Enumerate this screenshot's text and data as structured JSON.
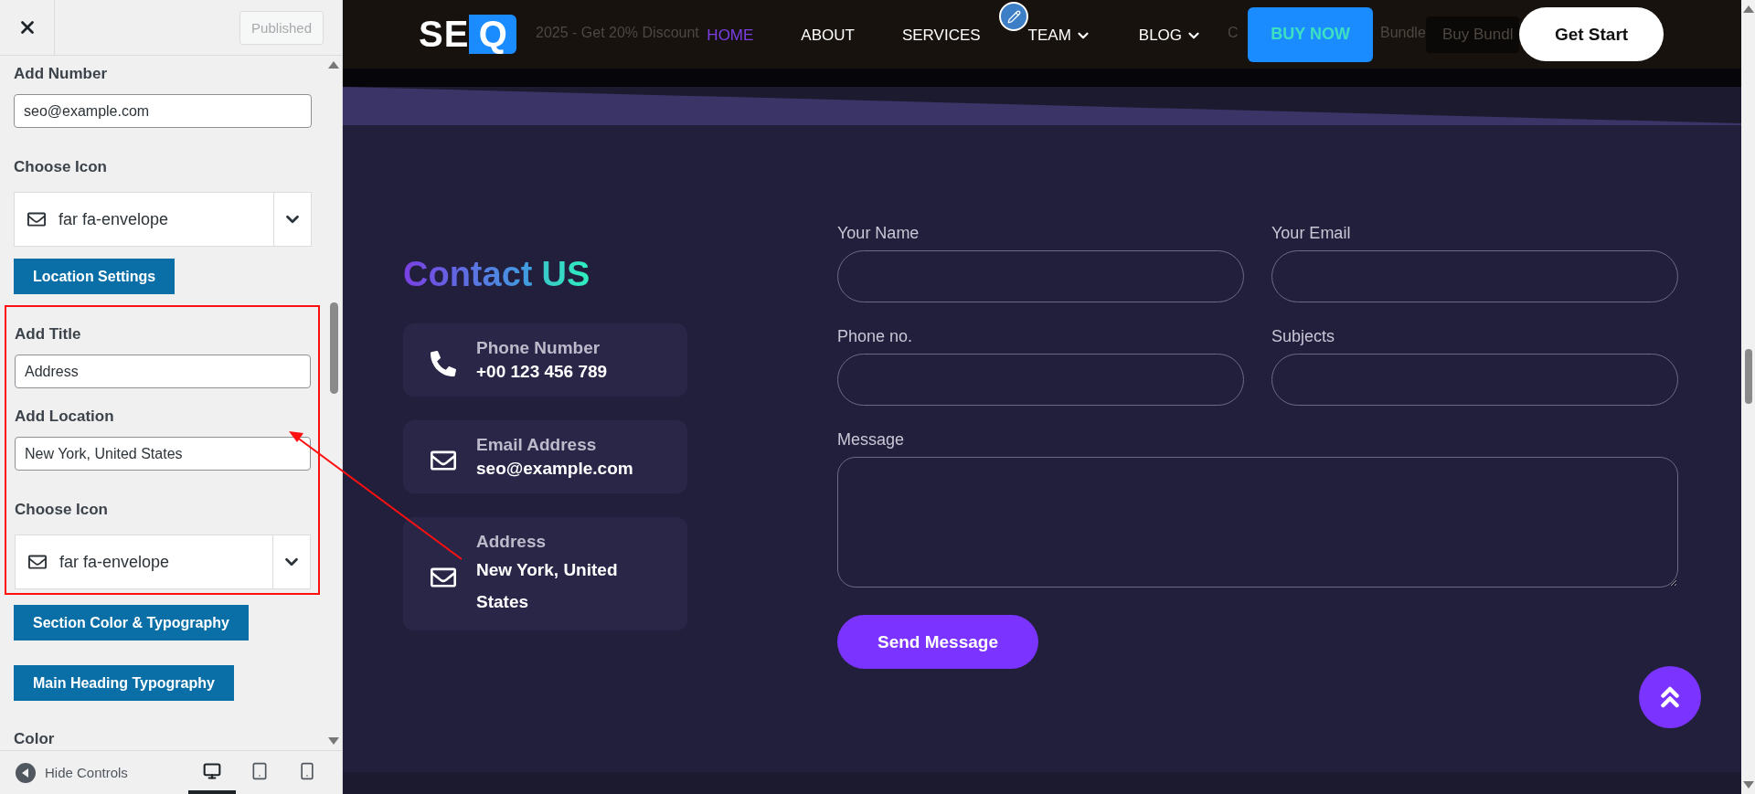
{
  "customizer": {
    "publish_button": "Published",
    "controls": [
      {
        "kind": "text",
        "label": "Add Number",
        "value": "seo@example.com"
      },
      {
        "kind": "icon_select",
        "label": "Choose Icon",
        "value": "far fa-envelope"
      },
      {
        "kind": "button",
        "label": "Location Settings"
      },
      {
        "kind": "group",
        "highlighted": true,
        "children": [
          {
            "kind": "text",
            "label": "Add Title",
            "value": "Address"
          },
          {
            "kind": "text",
            "label": "Add Location",
            "value": "New York, United States"
          },
          {
            "kind": "icon_select",
            "label": "Choose Icon",
            "value": "far fa-envelope"
          }
        ]
      },
      {
        "kind": "button",
        "label": "Section Color & Typography"
      },
      {
        "kind": "button",
        "label": "Main Heading Typography"
      },
      {
        "kind": "heading",
        "label": "Color"
      }
    ],
    "hide_controls": "Hide Controls",
    "devices": [
      {
        "kind": "desktop",
        "selected": true
      },
      {
        "kind": "tablet",
        "selected": false
      },
      {
        "kind": "mobile",
        "selected": false
      }
    ]
  },
  "preview": {
    "banner": [
      {
        "kind": "text",
        "text": "2025 - Get 20% Discount"
      },
      {
        "kind": "text",
        "text": "C"
      },
      {
        "kind": "text",
        "text": "Bundle"
      },
      {
        "kind": "pill",
        "text": "Buy Bundl"
      }
    ],
    "logo": {
      "text": "SE",
      "mark": "Q"
    },
    "nav": [
      {
        "label": "HOME",
        "selected": true,
        "dropdown": false
      },
      {
        "label": "ABOUT",
        "selected": false,
        "dropdown": false
      },
      {
        "label": "SERVICES",
        "selected": false,
        "dropdown": false
      },
      {
        "label": "TEAM",
        "selected": false,
        "dropdown": true
      },
      {
        "label": "BLOG",
        "selected": false,
        "dropdown": true
      }
    ],
    "buy_button": "BUY NOW",
    "start_button": "Get Start",
    "contact": {
      "title": "Contact",
      "title_accent": "US",
      "cards": [
        {
          "kind": "phone",
          "label": "Phone Number",
          "value": "+00 123 456 789"
        },
        {
          "kind": "envelope",
          "label": "Email Address",
          "value": "seo@example.com"
        },
        {
          "kind": "envelope",
          "label": "Address",
          "value": "New York, United States"
        }
      ],
      "fields": [
        {
          "label": "Your Name"
        },
        {
          "label": "Your Email"
        },
        {
          "label": "Phone no."
        },
        {
          "label": "Subjects"
        }
      ],
      "message_label": "Message",
      "send_button": "Send Message"
    }
  }
}
